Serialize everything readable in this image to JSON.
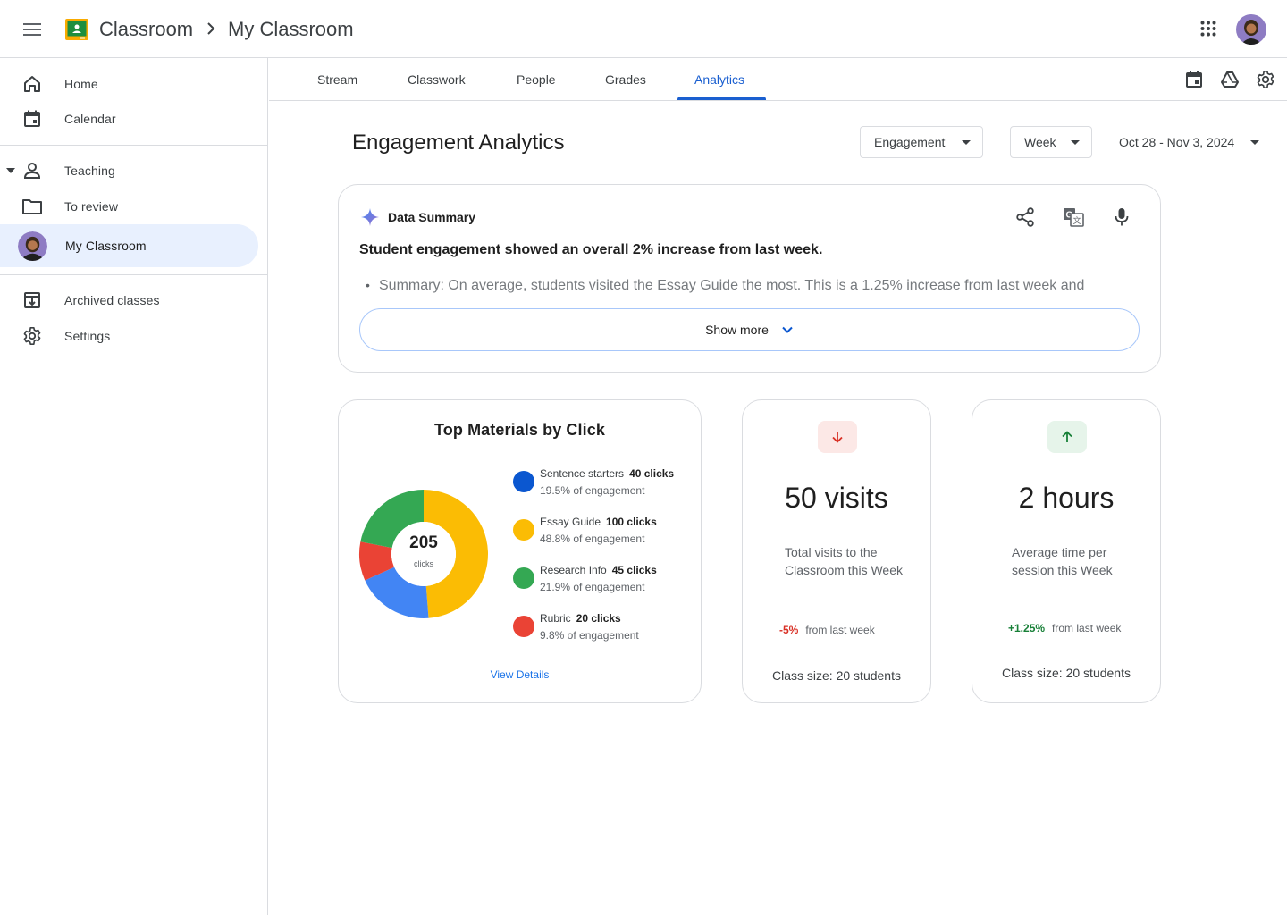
{
  "header": {
    "brand": "Classroom",
    "breadcrumb_current": "My Classroom"
  },
  "sidebar": {
    "items": [
      {
        "label": "Home",
        "icon": "home-icon"
      },
      {
        "label": "Calendar",
        "icon": "calendar-icon"
      },
      {
        "label": "Teaching",
        "icon": "person-icon"
      },
      {
        "label": "To review",
        "icon": "folder-icon"
      },
      {
        "label": "My Classroom",
        "icon": "avatar"
      },
      {
        "label": "Archived classes",
        "icon": "archive-icon"
      },
      {
        "label": "Settings",
        "icon": "gear-icon"
      }
    ]
  },
  "tabs": [
    {
      "label": "Stream"
    },
    {
      "label": "Classwork"
    },
    {
      "label": "People"
    },
    {
      "label": "Grades"
    },
    {
      "label": "Analytics",
      "active": true
    }
  ],
  "page": {
    "title": "Engagement Analytics",
    "metric_filter": "Engagement",
    "period_filter": "Week",
    "date_range": "Oct 28 - Nov 3, 2024"
  },
  "summary": {
    "title": "Data Summary",
    "headline": "Student engagement showed an overall 2% increase from last week.",
    "bullet": "Summary: On average, students visited the Essay Guide the most. This is a 1.25% increase from last week and",
    "show_more": "Show more"
  },
  "materials": {
    "title": "Top Materials by Click",
    "total": "205",
    "total_unit": "clicks",
    "view_details": "View Details",
    "items": [
      {
        "name": "Sentence starters",
        "clicks_label": "40 clicks",
        "share_label": "19.5% of engagement",
        "clicks": 40,
        "color": "#0b57d0"
      },
      {
        "name": "Essay Guide",
        "clicks_label": "100 clicks",
        "share_label": "48.8% of engagement",
        "clicks": 100,
        "color": "#fbbc04"
      },
      {
        "name": "Research Info",
        "clicks_label": "45 clicks",
        "share_label": "21.9% of engagement",
        "clicks": 45,
        "color": "#34a853"
      },
      {
        "name": "Rubric",
        "clicks_label": "20 clicks",
        "share_label": "9.8% of engagement",
        "clicks": 20,
        "color": "#ea4335"
      }
    ]
  },
  "chart_data": {
    "type": "pie",
    "categories": [
      "Essay Guide",
      "Sentence starters",
      "Rubric",
      "Research Info"
    ],
    "values": [
      100,
      40,
      20,
      45
    ],
    "colors": [
      "#fbbc04",
      "#4285f4",
      "#ea4335",
      "#34a853"
    ],
    "title": "Top Materials by Click",
    "center_label": "205"
  },
  "stats": [
    {
      "value": "50 visits",
      "description": "Total visits to the Classroom this Week",
      "change": "-5%",
      "change_suffix": "from last week",
      "trend": "down",
      "trend_color": "#d93025",
      "class_size": "Class size: 20 students"
    },
    {
      "value": "2 hours",
      "description": "Average time per session this Week",
      "change": "+1.25%",
      "change_suffix": "from last week",
      "trend": "up",
      "trend_color": "#188038",
      "class_size": "Class size: 20 students"
    }
  ],
  "colors": {
    "accent": "#1a5fd0",
    "active_nav_bg": "#e8f0fe",
    "border": "#dadce0"
  }
}
